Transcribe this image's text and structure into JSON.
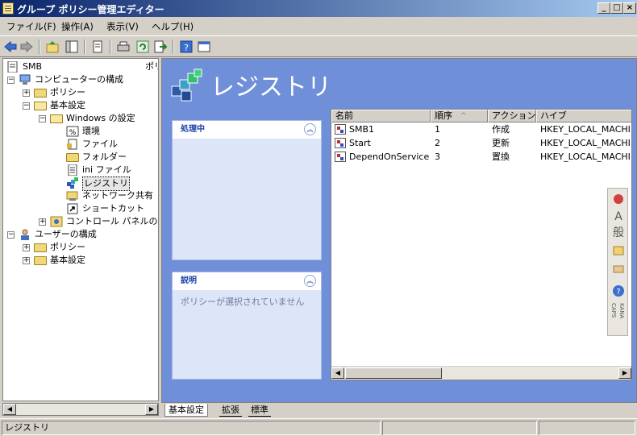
{
  "window": {
    "title": "グループ ポリシー管理エディター",
    "controls": [
      "_",
      "□",
      "×"
    ]
  },
  "menu": [
    "ファイル(F)",
    "操作(A)",
    "表示(V)",
    "ヘルプ(H)"
  ],
  "toolbar_icons": [
    "back-arrow-icon",
    "forward-arrow-icon",
    "up-folder-icon",
    "show-hide-tree-icon",
    "copy-icon",
    "print-icon",
    "refresh-icon",
    "export-icon",
    "help-icon",
    "properties-icon"
  ],
  "tree": {
    "root": "SMB",
    "root_suffix": "ポリ",
    "nodes": [
      {
        "label": "コンピューターの構成",
        "exp": "−"
      },
      {
        "label": "ポリシー",
        "exp": "+"
      },
      {
        "label": "基本設定",
        "exp": "−"
      },
      {
        "label": "Windows の設定",
        "exp": "−"
      },
      {
        "label": "環境"
      },
      {
        "label": "ファイル"
      },
      {
        "label": "フォルダー"
      },
      {
        "label": "ini ファイル"
      },
      {
        "label": "レジストリ"
      },
      {
        "label": "ネットワーク共有"
      },
      {
        "label": "ショートカット"
      },
      {
        "label": "コントロール パネルの設",
        "exp": "+"
      },
      {
        "label": "ユーザーの構成",
        "exp": "−"
      },
      {
        "label": "ポリシー",
        "exp": "+"
      },
      {
        "label": "基本設定",
        "exp": "+"
      }
    ]
  },
  "content": {
    "title": "レジストリ",
    "processing_panel": {
      "title": "処理中"
    },
    "description_panel": {
      "title": "説明",
      "text": "ポリシーが選択されていません"
    },
    "columns": [
      "名前",
      "順序",
      "アクション",
      "ハイブ"
    ],
    "sort_indicator": "^",
    "rows": [
      {
        "name": "SMB1",
        "order": "1",
        "action": "作成",
        "hive": "HKEY_LOCAL_MACHI..."
      },
      {
        "name": "Start",
        "order": "2",
        "action": "更新",
        "hive": "HKEY_LOCAL_MACHI..."
      },
      {
        "name": "DependOnService",
        "order": "3",
        "action": "置換",
        "hive": "HKEY_LOCAL_MACHI..."
      }
    ]
  },
  "side_toolbar": {
    "letter_a": "A",
    "han": "般",
    "caps": "CAPS",
    "kana": "KANA"
  },
  "tabs": [
    "基本設定",
    "拡張",
    "標準"
  ],
  "status": {
    "text": "レジストリ"
  }
}
